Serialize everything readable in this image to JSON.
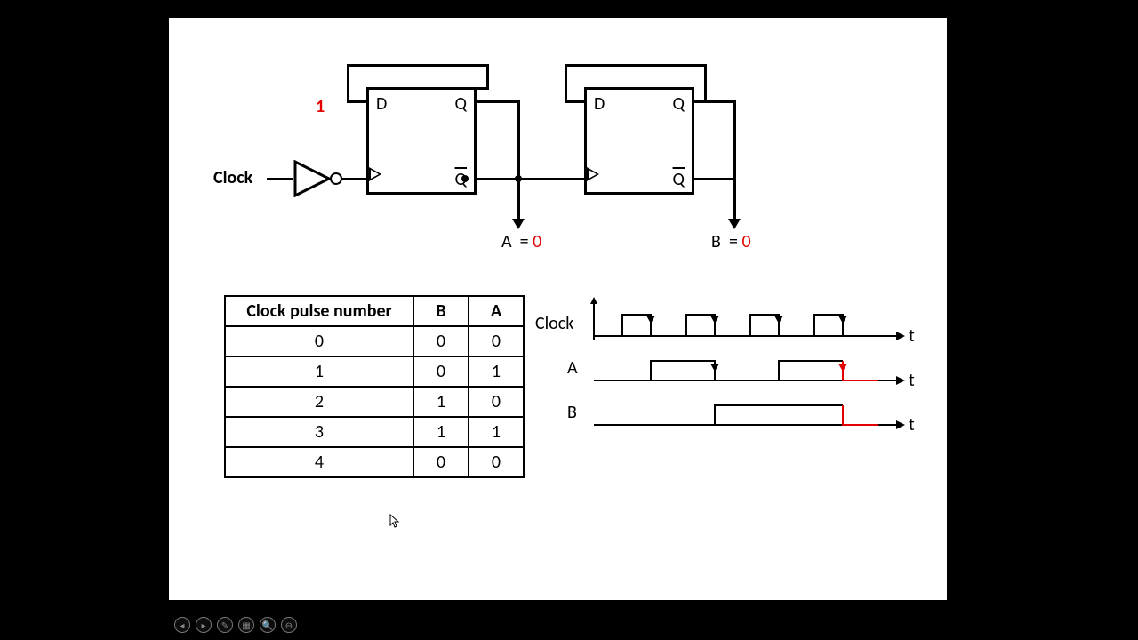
{
  "circuit": {
    "clock_label": "Clock",
    "d_input_initial": "1",
    "ff_labels": {
      "d": "D",
      "q": "Q",
      "qbar": "Q"
    },
    "out_a": {
      "name": "A",
      "eq": "=",
      "val": "0"
    },
    "out_b": {
      "name": "B",
      "eq": "=",
      "val": "0"
    }
  },
  "table": {
    "headers": [
      "Clock pulse number",
      "B",
      "A"
    ],
    "rows": [
      [
        "0",
        "0",
        "0"
      ],
      [
        "1",
        "0",
        "1"
      ],
      [
        "2",
        "1",
        "0"
      ],
      [
        "3",
        "1",
        "1"
      ],
      [
        "4",
        "0",
        "0"
      ]
    ]
  },
  "timing": {
    "labels": {
      "clock": "Clock",
      "a": "A",
      "b": "B",
      "t": "t"
    }
  },
  "chart_data": {
    "type": "table",
    "description": "2-bit ripple counter using two D flip-flops with Q-bar fed back to D; outputs A (LSB) and B (MSB) over clock pulses.",
    "columns": [
      "ClockPulse",
      "B",
      "A"
    ],
    "rows": [
      [
        0,
        0,
        0
      ],
      [
        1,
        0,
        1
      ],
      [
        2,
        1,
        0
      ],
      [
        3,
        1,
        1
      ],
      [
        4,
        0,
        0
      ]
    ],
    "timing": {
      "clock": {
        "period": 1,
        "pulses": 4,
        "trigger": "falling-edge"
      },
      "A": [
        0,
        1,
        0,
        1,
        0
      ],
      "B": [
        0,
        0,
        1,
        1,
        0
      ]
    }
  },
  "controls": [
    "◂",
    "▸",
    "✎",
    "▦",
    "🔍",
    "⊖"
  ]
}
